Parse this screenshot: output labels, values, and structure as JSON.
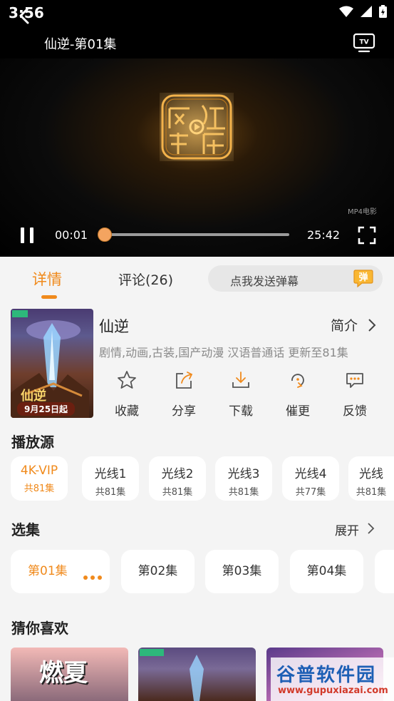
{
  "status_bar": {
    "time": "3:56"
  },
  "header": {
    "title": "仙逆-第01集"
  },
  "player": {
    "watermark": "MP4电影",
    "current_time": "00:01",
    "duration": "25:42",
    "progress": 0.0
  },
  "tabs": [
    {
      "label": "详情",
      "active": true
    },
    {
      "label": "评论(26)",
      "active": false
    }
  ],
  "danmu": {
    "placeholder": "点我发送弹幕",
    "icon_label": "弹"
  },
  "show": {
    "poster_badge": "9月25日起",
    "poster_title": "仙逆",
    "title": "仙逆",
    "intro_label": "简介",
    "meta": "剧情,动画,古装,国产动漫 汉语普通话 更新至81集"
  },
  "actions": [
    {
      "icon": "star-icon",
      "label": "收藏"
    },
    {
      "icon": "share-icon",
      "label": "分享"
    },
    {
      "icon": "download-icon",
      "label": "下载"
    },
    {
      "icon": "urge-icon",
      "label": "催更"
    },
    {
      "icon": "feedback-icon",
      "label": "反馈"
    }
  ],
  "sources": {
    "title": "播放源",
    "items": [
      {
        "name": "4K-VIP",
        "count": "共81集",
        "active": true
      },
      {
        "name": "光线1",
        "count": "共81集",
        "active": false
      },
      {
        "name": "光线2",
        "count": "共81集",
        "active": false
      },
      {
        "name": "光线3",
        "count": "共81集",
        "active": false
      },
      {
        "name": "光线4",
        "count": "共77集",
        "active": false
      },
      {
        "name": "光线",
        "count": "共81集",
        "active": false
      }
    ]
  },
  "episodes": {
    "title": "选集",
    "expand_label": "展开",
    "items": [
      "第01集",
      "第02集",
      "第03集",
      "第04集"
    ]
  },
  "recommend": {
    "title": "猜你喜欢",
    "first_title": "燃夏"
  },
  "site_mark": {
    "name": "谷普软件园",
    "url": "www.gupuxiazai.com"
  },
  "colors": {
    "accent": "#f08a1c"
  }
}
